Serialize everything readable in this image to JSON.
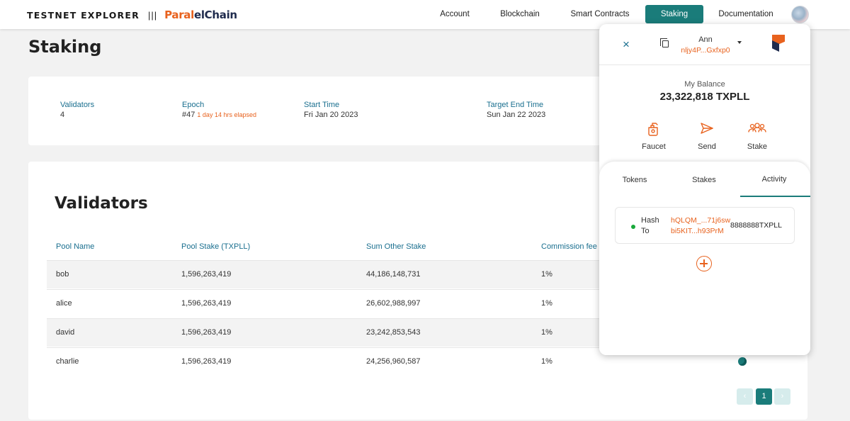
{
  "brand": {
    "explorer": "TESTNET EXPLORER",
    "separator": "|||",
    "logo_part1": "Paral",
    "logo_part2": "elChain"
  },
  "nav": [
    {
      "label": "Account"
    },
    {
      "label": "Blockchain"
    },
    {
      "label": "Smart Contracts"
    },
    {
      "label": "Staking",
      "active": true
    },
    {
      "label": "Documentation"
    }
  ],
  "page_title": "Staking",
  "epoch_card": {
    "validators": {
      "label": "Validators",
      "value": "4"
    },
    "epoch": {
      "label": "Epoch",
      "value": "#47",
      "elapsed": "1 day 14 hrs elapsed"
    },
    "start_time": {
      "label": "Start Time",
      "value": "Fri Jan 20 2023"
    },
    "target_end_time": {
      "label": "Target End Time",
      "value": "Sun Jan 22 2023"
    }
  },
  "validators": {
    "title": "Validators",
    "columns": [
      "Pool Name",
      "Pool Stake (TXPLL)",
      "Sum Other Stake",
      "Commission fee"
    ],
    "rows": [
      {
        "pool_name": "bob",
        "pool_stake": "1,596,263,419",
        "sum_other_stake": "44,186,148,731",
        "commission": "1%"
      },
      {
        "pool_name": "alice",
        "pool_stake": "1,596,263,419",
        "sum_other_stake": "26,602,988,997",
        "commission": "1%"
      },
      {
        "pool_name": "david",
        "pool_stake": "1,596,263,419",
        "sum_other_stake": "23,242,853,543",
        "commission": "1%"
      },
      {
        "pool_name": "charlie",
        "pool_stake": "1,596,263,419",
        "sum_other_stake": "24,256,960,587",
        "commission": "1%"
      }
    ]
  },
  "pagination": {
    "prev": "‹",
    "current": "1",
    "next": "›"
  },
  "wallet": {
    "close_icon": "×",
    "account_name": "Ann",
    "account_address": "nljy4P...Gxfxp0",
    "balance_label": "My Balance",
    "balance": "23,322,818 TXPLL",
    "actions": [
      "Faucet",
      "Send",
      "Stake"
    ],
    "tabs": [
      "Tokens",
      "Stakes",
      "Activity"
    ],
    "active_tab": "Activity",
    "activity": [
      {
        "hash_label": "Hash",
        "to_label": "To",
        "hash": "hQLQM_...71j6sw",
        "to": "bi5KIT...h93PrM",
        "amount": "8888888TXPLL"
      }
    ]
  },
  "colors": {
    "accent": "#1a7c7a",
    "orange": "#e8621e",
    "link_blue": "#1a6f8f",
    "status_green": "#18a83a"
  }
}
